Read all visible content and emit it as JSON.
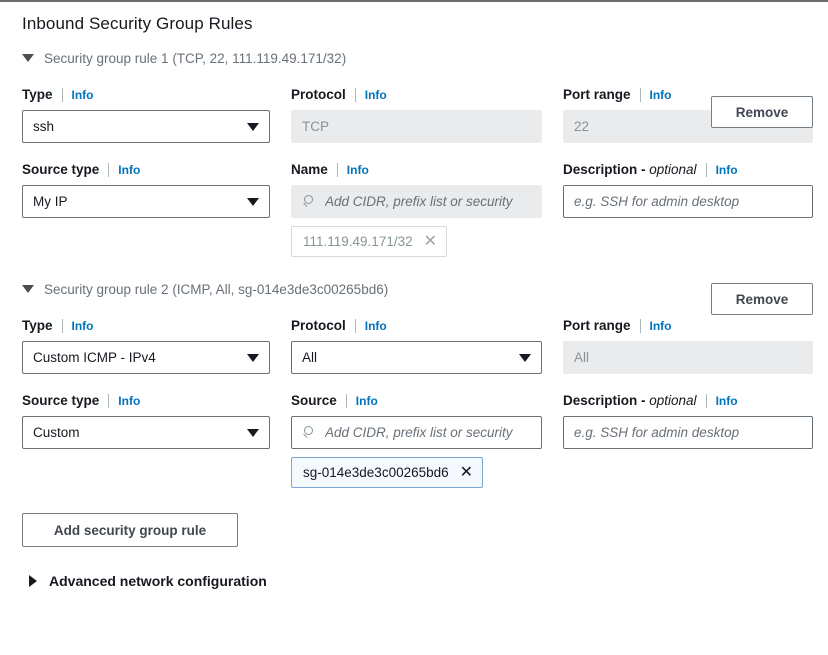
{
  "section": {
    "title": "Inbound Security Group Rules"
  },
  "labels": {
    "type": "Type",
    "protocol": "Protocol",
    "port_range": "Port range",
    "source_type": "Source type",
    "name": "Name",
    "source": "Source",
    "description": "Description - ",
    "description_optional": "optional",
    "info": "Info"
  },
  "icons": {
    "expanded": "caret-down-icon",
    "collapsed": "caret-right-icon",
    "search": "search-icon",
    "remove_token": "close-icon",
    "dropdown": "chevron-down-icon"
  },
  "colors": {
    "link": "#0073bb",
    "chip_border_active": "#7da8d4",
    "chip_fill_active": "#f4f9fd",
    "disabled_fill": "#e9ebed",
    "border": "#687078",
    "muted_text": "#687078"
  },
  "rules": [
    {
      "header": "Security group rule 1 (TCP, 22, 111.119.49.171/32)",
      "remove_label": "Remove",
      "type_value": "ssh",
      "protocol_value": "TCP",
      "protocol_disabled": true,
      "port_range_value": "22",
      "port_range_disabled": true,
      "source_type_value": "My IP",
      "source_label": "Name",
      "source_placeholder": "Add CIDR, prefix list or security",
      "source_disabled": true,
      "token": "111.119.49.171/32",
      "token_active": false,
      "description_placeholder": "e.g. SSH for admin desktop",
      "description_value": ""
    },
    {
      "header": "Security group rule 2 (ICMP, All, sg-014e3de3c00265bd6)",
      "remove_label": "Remove",
      "type_value": "Custom ICMP - IPv4",
      "protocol_value": "All",
      "protocol_disabled": false,
      "port_range_value": "All",
      "port_range_disabled": true,
      "source_type_value": "Custom",
      "source_label": "Source",
      "source_placeholder": "Add CIDR, prefix list or security",
      "source_disabled": false,
      "token": "sg-014e3de3c00265bd6",
      "token_active": true,
      "description_placeholder": "e.g. SSH for admin desktop",
      "description_value": ""
    }
  ],
  "footer": {
    "add_rule_label": "Add security group rule",
    "advanced_label": "Advanced network configuration",
    "advanced_expanded": false
  }
}
